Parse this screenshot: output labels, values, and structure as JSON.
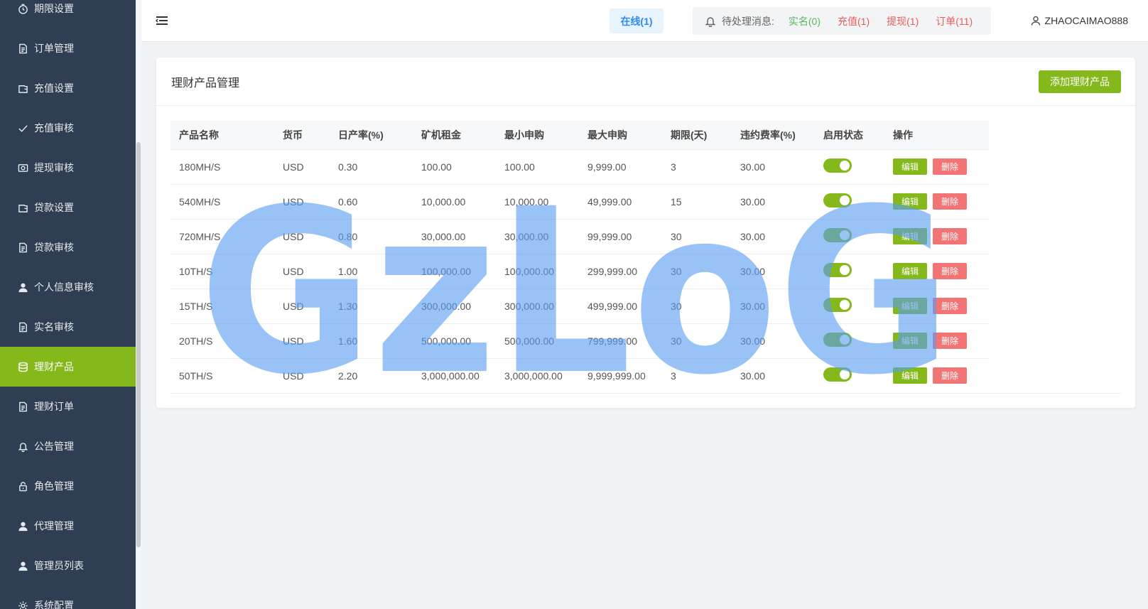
{
  "sidebar": {
    "items": [
      {
        "label": "期限设置",
        "icon": "clock-icon",
        "active": false
      },
      {
        "label": "订单管理",
        "icon": "document-icon",
        "active": false
      },
      {
        "label": "充值设置",
        "icon": "wallet-icon",
        "active": false
      },
      {
        "label": "充值审核",
        "icon": "check-icon",
        "active": false
      },
      {
        "label": "提现审核",
        "icon": "withdraw-icon",
        "active": false
      },
      {
        "label": "贷款设置",
        "icon": "wallet-icon",
        "active": false
      },
      {
        "label": "贷款审核",
        "icon": "document-icon",
        "active": false
      },
      {
        "label": "个人信息审核",
        "icon": "user-icon",
        "active": false
      },
      {
        "label": "实名审核",
        "icon": "document-icon",
        "active": false
      },
      {
        "label": "理财产品",
        "icon": "database-icon",
        "active": true
      },
      {
        "label": "理财订单",
        "icon": "document-icon",
        "active": false
      },
      {
        "label": "公告管理",
        "icon": "bell-icon",
        "active": false
      },
      {
        "label": "角色管理",
        "icon": "lock-icon",
        "active": false
      },
      {
        "label": "代理管理",
        "icon": "user-icon",
        "active": false
      },
      {
        "label": "管理员列表",
        "icon": "user-icon",
        "active": false
      },
      {
        "label": "系统配置",
        "icon": "gear-icon",
        "active": false
      }
    ]
  },
  "header": {
    "online": "在线(1)",
    "pending_label": "待处理消息:",
    "pending": [
      {
        "label": "实名(0)",
        "color": "green"
      },
      {
        "label": "充值(1)",
        "color": "red"
      },
      {
        "label": "提现(1)",
        "color": "red"
      },
      {
        "label": "订单(11)",
        "color": "red"
      }
    ],
    "username": "ZHAOCAIMAO888"
  },
  "card": {
    "title": "理财产品管理",
    "add_button": "添加理财产品"
  },
  "table": {
    "headers": [
      "产品名称",
      "货币",
      "日产率(%)",
      "矿机租金",
      "最小申购",
      "最大申购",
      "期限(天)",
      "违约费率(%)",
      "启用状态",
      "操作"
    ],
    "rows": [
      [
        "180MH/S",
        "USD",
        "0.30",
        "100.00",
        "100.00",
        "9,999.00",
        "3",
        "30.00"
      ],
      [
        "540MH/S",
        "USD",
        "0.60",
        "10,000.00",
        "10,000.00",
        "49,999.00",
        "15",
        "30.00"
      ],
      [
        "720MH/S",
        "USD",
        "0.80",
        "30,000.00",
        "30,000.00",
        "99,999.00",
        "30",
        "30.00"
      ],
      [
        "10TH/S",
        "USD",
        "1.00",
        "100,000.00",
        "100,000.00",
        "299,999.00",
        "30",
        "30.00"
      ],
      [
        "15TH/S",
        "USD",
        "1.30",
        "300,000.00",
        "300,000.00",
        "499,999.00",
        "30",
        "30.00"
      ],
      [
        "20TH/S",
        "USD",
        "1.60",
        "500,000.00",
        "500,000.00",
        "799,999.00",
        "30",
        "30.00"
      ],
      [
        "50TH/S",
        "USD",
        "2.20",
        "3,000,000.00",
        "3,000,000.00",
        "9,999,999.00",
        "3",
        "30.00"
      ]
    ],
    "edit_label": "编辑",
    "delete_label": "删除"
  },
  "watermark": "GzLoG",
  "colors": {
    "sidebar_bg": "#2f3e52",
    "accent": "#85b91b",
    "danger": "#f27474",
    "online_blue": "#2d8cf0"
  }
}
